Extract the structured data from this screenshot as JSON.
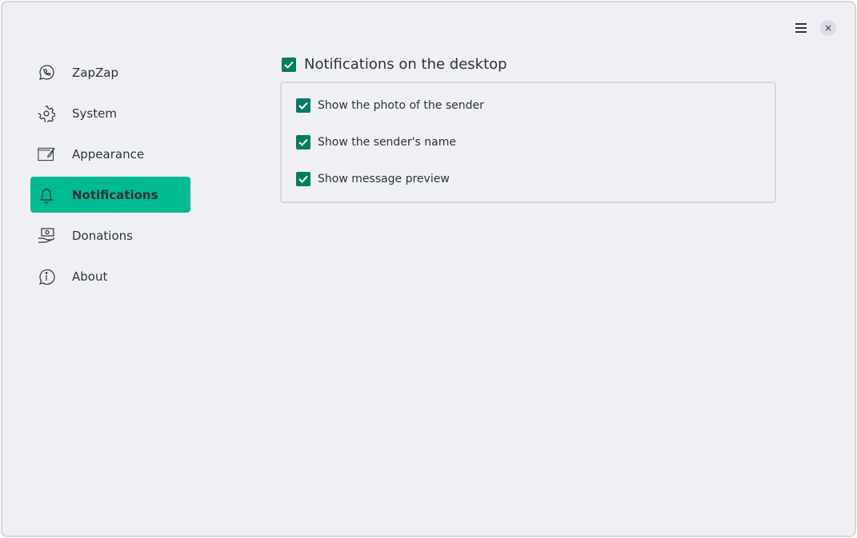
{
  "sidebar": {
    "items": [
      {
        "label": "ZapZap",
        "icon": "whatsapp-icon"
      },
      {
        "label": "System",
        "icon": "gear-icon"
      },
      {
        "label": "Appearance",
        "icon": "appearance-icon"
      },
      {
        "label": "Notifications",
        "icon": "bell-icon",
        "active": true
      },
      {
        "label": "Donations",
        "icon": "donation-icon"
      },
      {
        "label": "About",
        "icon": "info-icon"
      }
    ]
  },
  "main": {
    "title": "Notifications on the desktop",
    "title_checked": true,
    "options": [
      {
        "label": "Show the photo of the sender",
        "checked": true
      },
      {
        "label": "Show the sender's name",
        "checked": true
      },
      {
        "label": "Show message preview",
        "checked": true
      }
    ]
  },
  "window": {
    "close_glyph": "×"
  },
  "colors": {
    "accent": "#00bb8f",
    "checkbox": "#027c62",
    "background": "#eff0f4"
  }
}
